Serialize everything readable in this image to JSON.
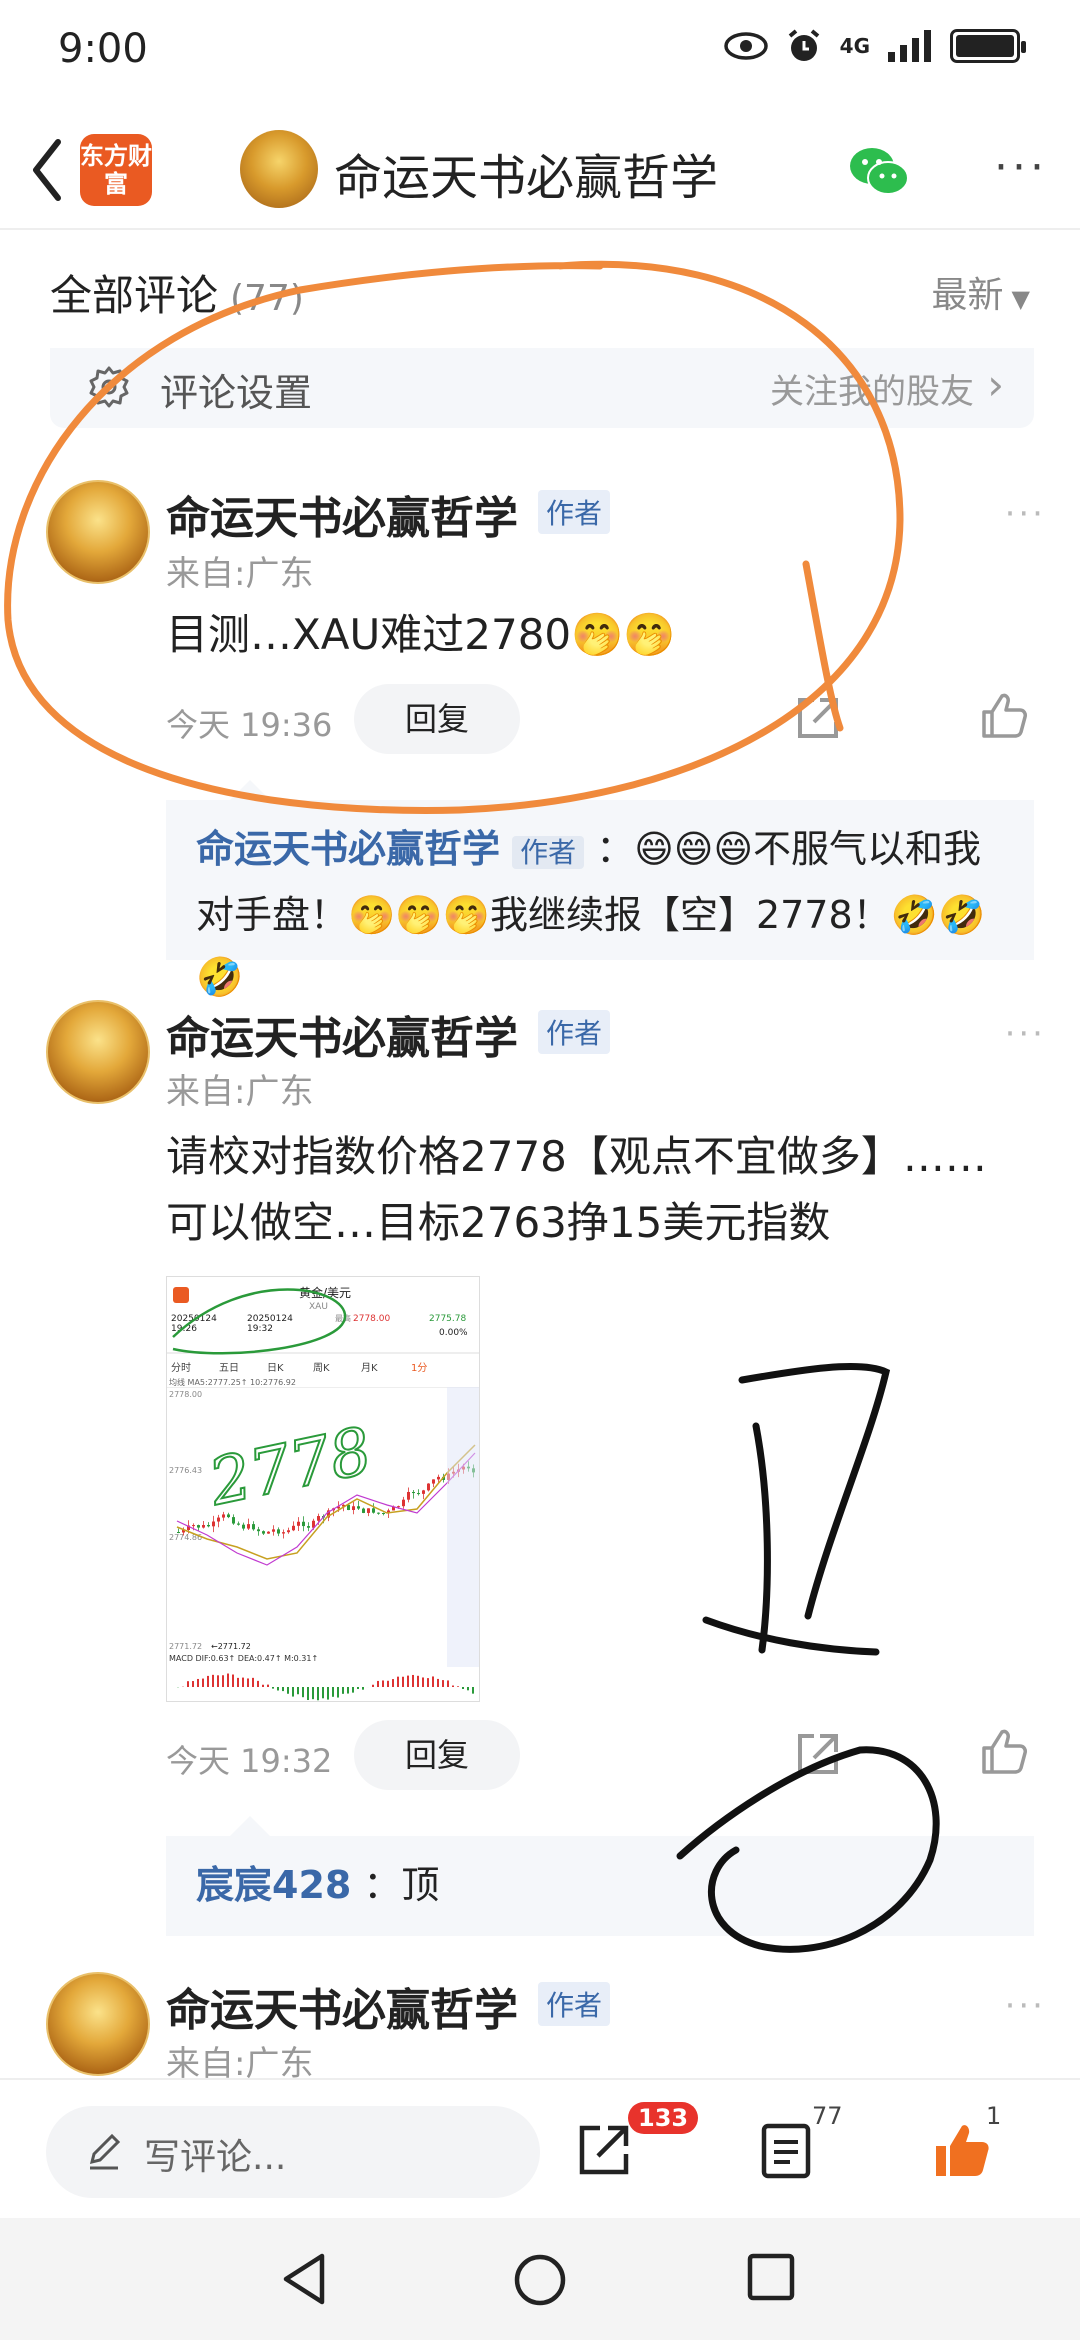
{
  "status_bar": {
    "time": "9:00",
    "network": "4G"
  },
  "header": {
    "app_logo": "东方财富",
    "title": "命运天书必赢哲学",
    "more": "···"
  },
  "comments_section": {
    "title": "全部评论",
    "count": "(77)",
    "sort": "最新",
    "settings_label": "评论设置",
    "settings_right": "关注我的股友"
  },
  "comments": [
    {
      "username": "命运天书必赢哲学",
      "badge": "作者",
      "location": "来自:广东",
      "text": "目测…XAU难过2780🤭🤭",
      "time": "今天 19:36",
      "reply_label": "回复",
      "reply": {
        "name": "命运天书必赢哲学",
        "badge": "作者",
        "text": "：😄😄😄不服气以和我对手盘！🤭🤭🤭我继续报【空】2778！🤣🤣🤣"
      }
    },
    {
      "username": "命运天书必赢哲学",
      "badge": "作者",
      "location": "来自:广东",
      "text_line1": "请校对指数价格2778【观点不宜做多】……",
      "text_line2": "可以做空…目标2763挣15美元指数",
      "time": "今天 19:32",
      "reply_label": "回复",
      "reply": {
        "name": "宸宸428",
        "text": "：顶"
      }
    },
    {
      "username": "命运天书必赢哲学",
      "badge": "作者",
      "location": "来自:广东"
    }
  ],
  "thumbnail": {
    "title": "黄金/美元",
    "subtitle": "XAU",
    "date1": "20250124",
    "date2": "20250124",
    "time1": "19:26",
    "time2": "19:32",
    "high_label": "最高",
    "high_value": "2778.00",
    "price": "2775.78",
    "change": "0.00%",
    "tabs": [
      "分时",
      "五日",
      "日K",
      "周K",
      "月K",
      "1分"
    ],
    "ma_line": "均线 MA5:2777.25↑ 10:2776.92",
    "levels": [
      "2778.00",
      "2776.43",
      "2774.86",
      "2771.72"
    ],
    "low_mark": "←2771.72",
    "macd_line": "MACD DIF:0.63↑ DEA:0.47↑ M:0.31↑",
    "handwriting": "2778"
  },
  "bottom_bar": {
    "placeholder": "写评论...",
    "share_badge": "133",
    "comment_count": "77",
    "like_count": "1"
  },
  "colors": {
    "accent_blue": "#3a68a8",
    "logo_orange": "#ea5a22",
    "annotation_orange": "#f08a3c",
    "like_orange": "#f07020",
    "badge_red": "#e8332c"
  }
}
